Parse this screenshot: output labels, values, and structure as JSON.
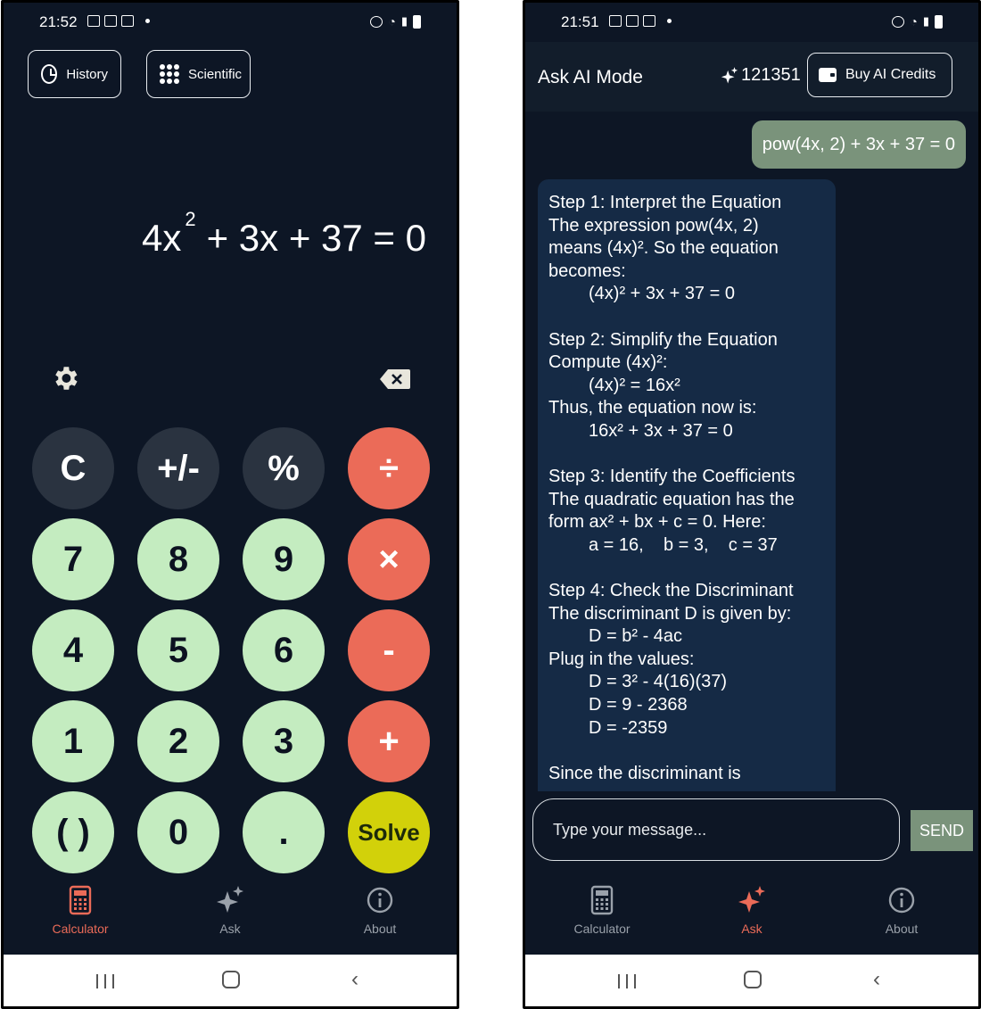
{
  "status_left": {
    "time": "21:52"
  },
  "status_right": {
    "time": "21:51"
  },
  "calculator": {
    "top_buttons": {
      "history": "History",
      "scientific": "Scientific"
    },
    "expression": {
      "base": "4x",
      "exponent": "2",
      "rest": "+ 3x + 37 = 0"
    },
    "keys": [
      "C",
      "+/-",
      "%",
      "÷",
      "7",
      "8",
      "9",
      "×",
      "4",
      "5",
      "6",
      "-",
      "1",
      "2",
      "3",
      "+",
      "( )",
      "0",
      ".",
      "Solve"
    ]
  },
  "nav": {
    "calculator": "Calculator",
    "ask": "Ask",
    "about": "About"
  },
  "ask": {
    "title": "Ask AI Mode",
    "credits": "121351",
    "buy_label": "Buy AI Credits",
    "user_message": "pow(4x, 2) + 3x + 37 = 0",
    "ai_lines": [
      "Step 1: Interpret the Equation",
      "The expression pow(4x, 2)",
      "means (4x)². So the equation",
      "becomes:",
      "(4x)² + 3x + 37 = 0",
      "",
      "Step 2: Simplify the Equation",
      "Compute (4x)²:",
      "(4x)² = 16x²",
      "Thus, the equation now is:",
      "16x² + 3x + 37 = 0",
      "",
      "Step 3: Identify the Coefficients",
      "The quadratic equation has the",
      "form ax² + bx + c = 0. Here:",
      "a = 16,    b = 3,    c = 37",
      "",
      "Step 4: Check the Discriminant",
      "The discriminant D is given by:",
      "D = b² - 4ac",
      "Plug in the values:",
      "D = 3² - 4(16)(37)",
      "D = 9 - 2368",
      "D = -2359",
      "",
      "Since the discriminant is"
    ],
    "input_placeholder": "Type your message...",
    "send_label": "SEND"
  },
  "colors": {
    "background": "#0d1625",
    "operator": "#eb6b58",
    "number": "#c4ecc0",
    "solve": "#d2d10a",
    "user_bubble": "#7a937b",
    "ai_bubble": "#152a45"
  }
}
